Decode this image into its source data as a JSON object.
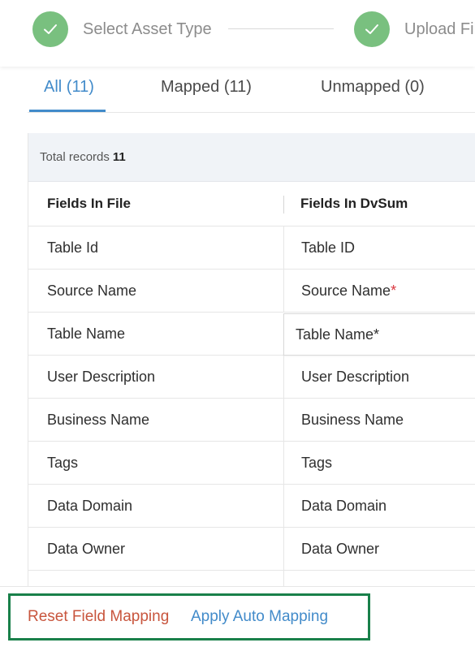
{
  "stepper": {
    "steps": [
      {
        "label": "Select Asset Type",
        "state": "completed"
      },
      {
        "label": "Upload File",
        "state": "completed"
      }
    ],
    "complete_color": "#79c07f"
  },
  "tabs": [
    {
      "label": "All (11)",
      "active": true
    },
    {
      "label": "Mapped (11)",
      "active": false
    },
    {
      "label": "Unmapped (0)",
      "active": false
    }
  ],
  "summary": {
    "label": "Total records",
    "count": "11"
  },
  "table": {
    "columns": [
      "Fields In File",
      "Fields In DvSum"
    ],
    "rows": [
      {
        "file": "Table Id",
        "dvsum": "Table ID",
        "required": false
      },
      {
        "file": "Source Name",
        "dvsum": "Source Name",
        "required": true
      },
      {
        "file": "Table Name",
        "dvsum": "Table Name*",
        "required": false,
        "editing": true
      },
      {
        "file": "User Description",
        "dvsum": "User Description",
        "required": false
      },
      {
        "file": "Business Name",
        "dvsum": "Business Name",
        "required": false
      },
      {
        "file": "Tags",
        "dvsum": "Tags",
        "required": false
      },
      {
        "file": "Data Domain",
        "dvsum": "Data Domain",
        "required": false
      },
      {
        "file": "Data Owner",
        "dvsum": "Data Owner",
        "required": false
      },
      {
        "file": "",
        "dvsum": "",
        "required": false
      }
    ],
    "required_marker": "*"
  },
  "footer": {
    "reset_label": "Reset Field Mapping",
    "auto_label": "Apply Auto Mapping",
    "highlight_color": "#19804a"
  },
  "colors": {
    "accent": "#428bca",
    "danger": "#c8553d"
  }
}
